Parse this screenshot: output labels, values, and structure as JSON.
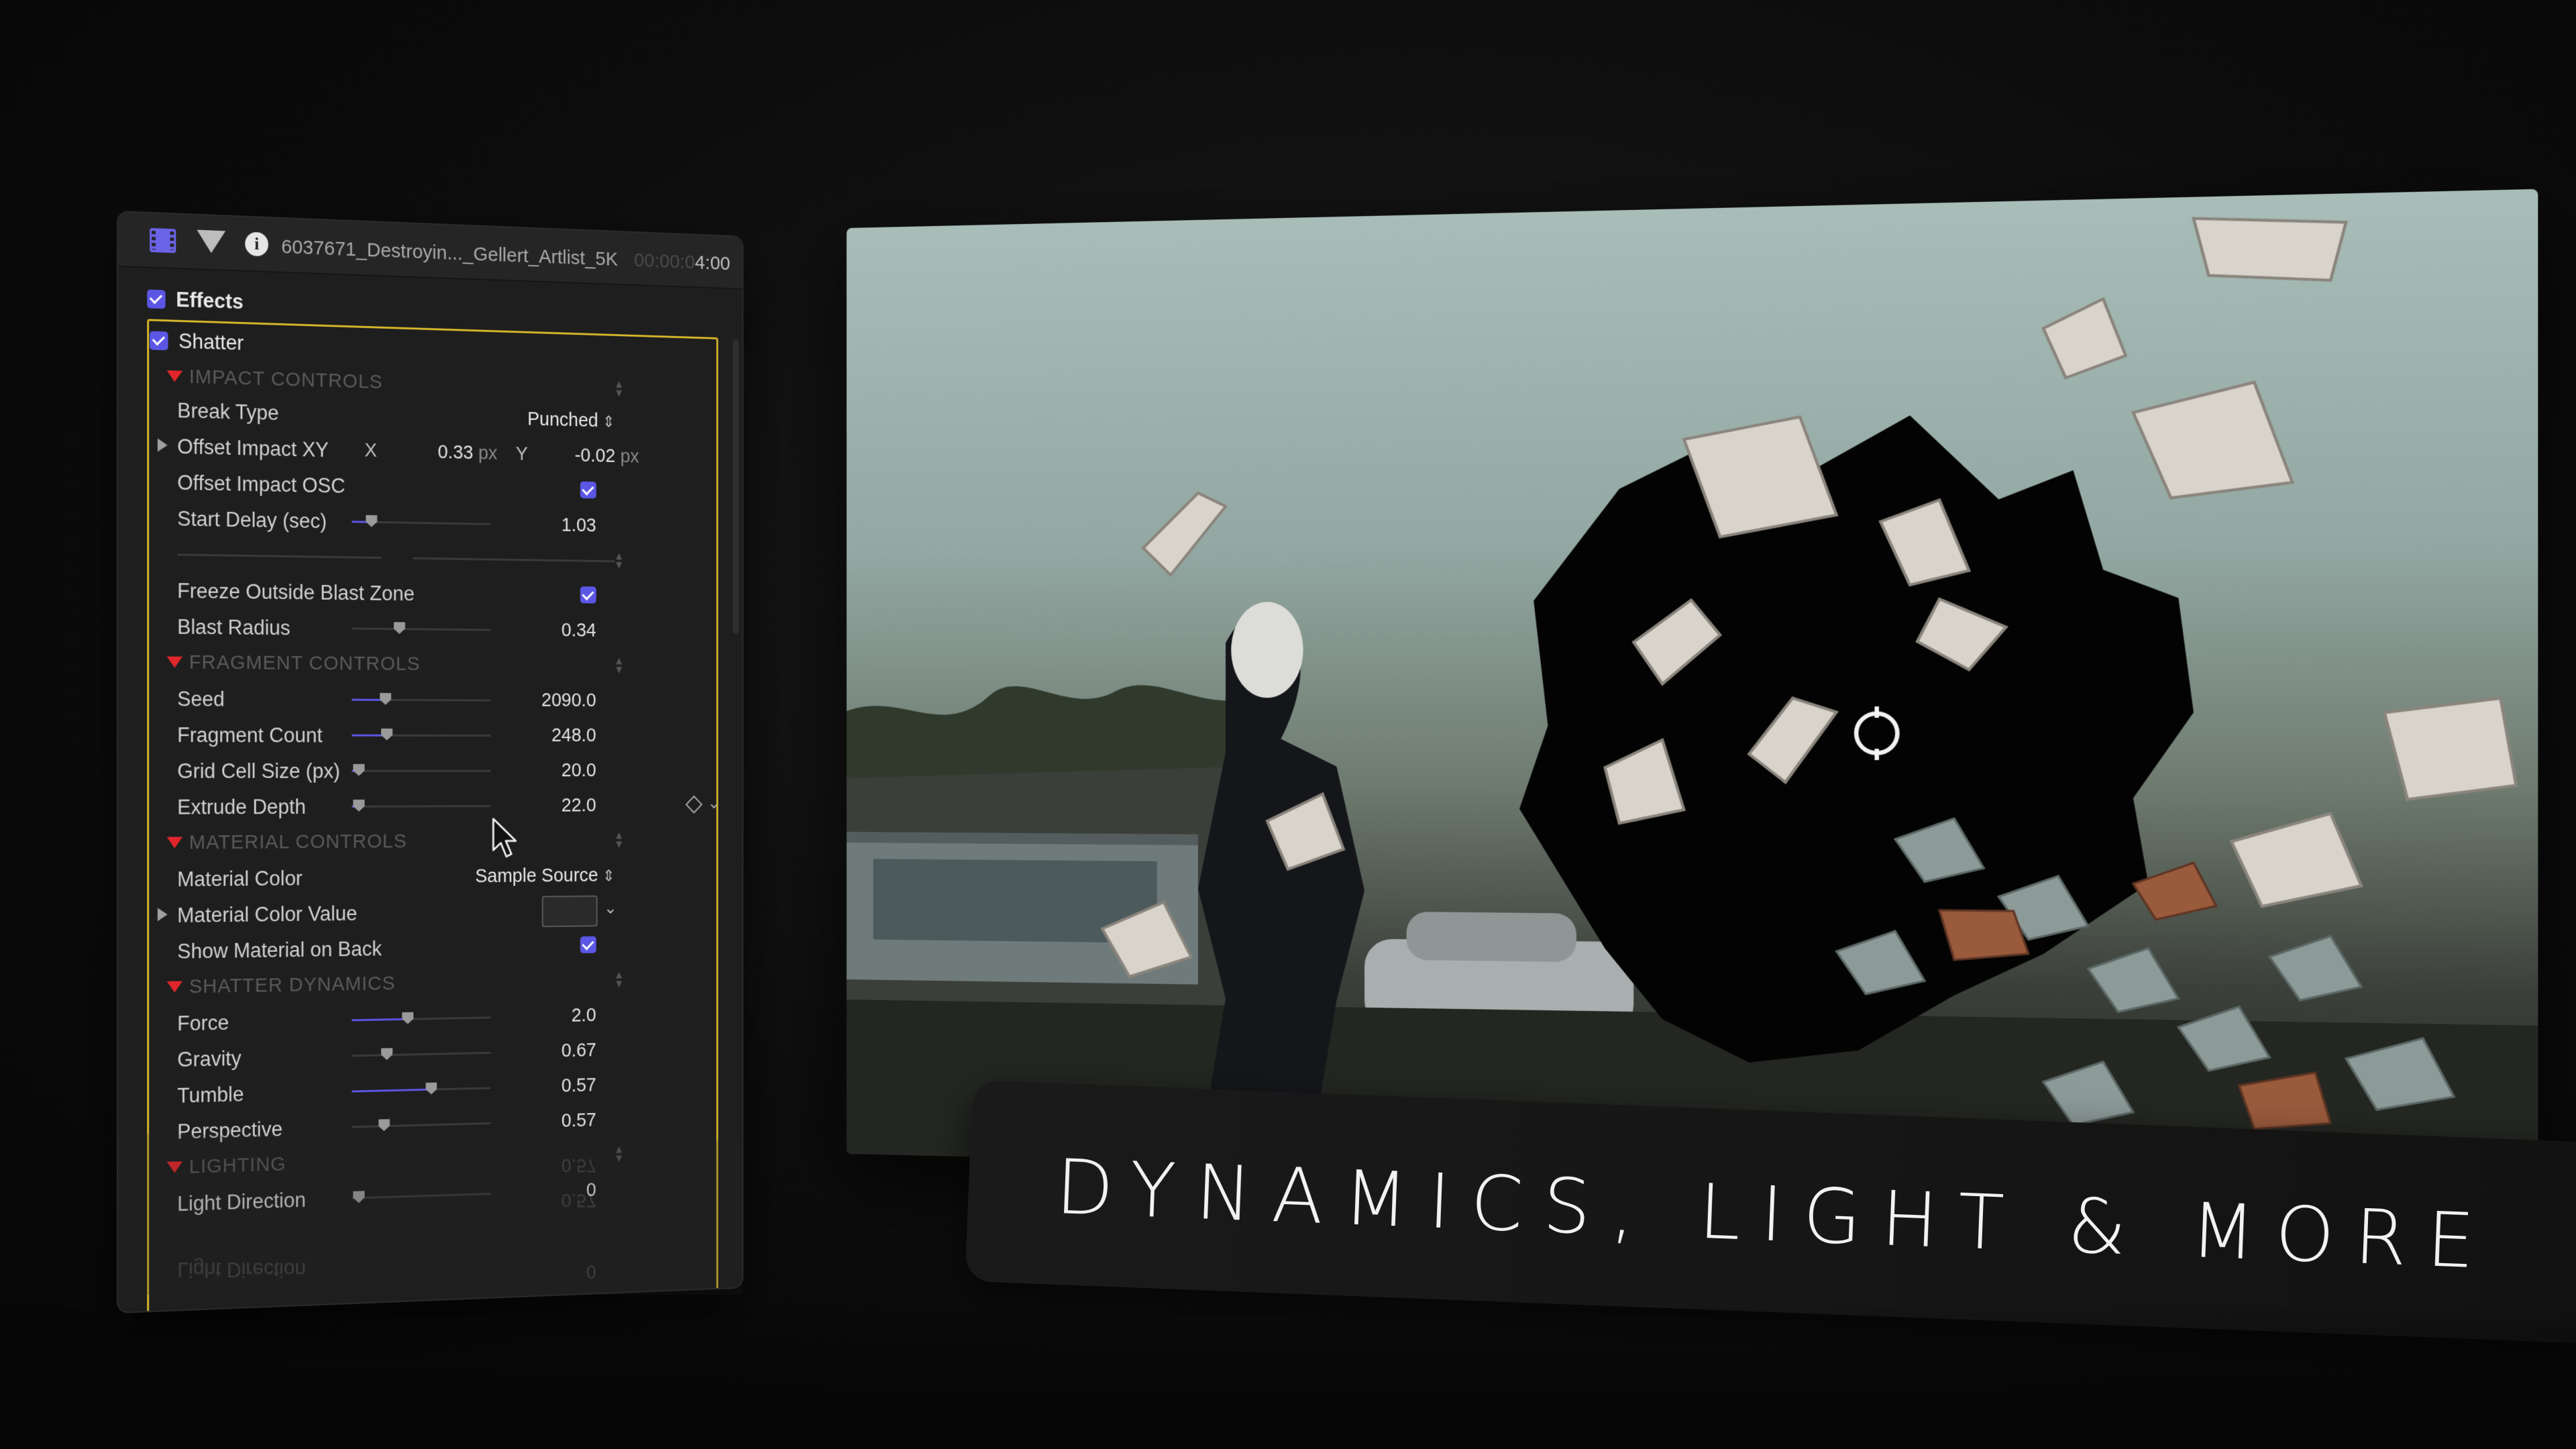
{
  "inspector": {
    "clip_title": "6037671_Destroyin..._Gellert_Artlist_5K",
    "timecode_dim": "00:00:0",
    "timecode_lit": "4:00",
    "effects_label": "Effects",
    "effect_name": "Shatter",
    "sections": {
      "impact": "IMPACT CONTROLS",
      "fragment": "FRAGMENT CONTROLS",
      "material": "MATERIAL CONTROLS",
      "dynamics": "SHATTER DYNAMICS",
      "lighting": "LIGHTING"
    },
    "params": {
      "break_type": {
        "label": "Break Type",
        "value": "Punched"
      },
      "offset_xy": {
        "label": "Offset Impact XY",
        "x_key": "X",
        "x": "0.33",
        "x_unit": "px",
        "y_key": "Y",
        "y": "-0.02",
        "y_unit": "px"
      },
      "offset_osc": {
        "label": "Offset Impact OSC",
        "checked": true
      },
      "start_delay": {
        "label": "Start Delay (sec)",
        "value": "1.03",
        "level": 0.14
      },
      "freeze_outside": {
        "label": "Freeze Outside Blast Zone",
        "checked": true
      },
      "blast_radius": {
        "label": "Blast Radius",
        "value": "0.34",
        "level": 0.34
      },
      "seed": {
        "label": "Seed",
        "value": "2090.0",
        "level": 0.24
      },
      "fragment_count": {
        "label": "Fragment Count",
        "value": "248.0",
        "level": 0.25
      },
      "grid_cell": {
        "label": "Grid Cell Size (px)",
        "value": "20.0",
        "level": 0.05
      },
      "extrude_depth": {
        "label": "Extrude Depth",
        "value": "22.0",
        "level": 0.05
      },
      "material_color": {
        "label": "Material Color",
        "value": "Sample Source"
      },
      "material_color_value": {
        "label": "Material Color Value"
      },
      "show_material_back": {
        "label": "Show Material on Back",
        "checked": true
      },
      "force": {
        "label": "Force",
        "value": "2.0",
        "level": 0.4
      },
      "gravity": {
        "label": "Gravity",
        "value": "0.67",
        "level": 0.25
      },
      "tumble": {
        "label": "Tumble",
        "value": "0.57",
        "level": 0.57
      },
      "perspective": {
        "label": "Perspective",
        "value": "0.57",
        "level": 0.23
      },
      "light_direction": {
        "label": "Light Direction",
        "value": "0",
        "level": 0.05
      }
    }
  },
  "tagline": "DYNAMICS, LIGHT & MORE",
  "colors": {
    "accent": "#5b56e4",
    "selection_outline": "#d6b72a",
    "disclosure_red": "#e0262a"
  },
  "icons": [
    "film-icon",
    "filter-icon",
    "info-icon",
    "checkbox-icon",
    "keyframe-diamond-icon",
    "chevron-down-icon",
    "cursor-pointer-icon",
    "impact-target-icon"
  ]
}
